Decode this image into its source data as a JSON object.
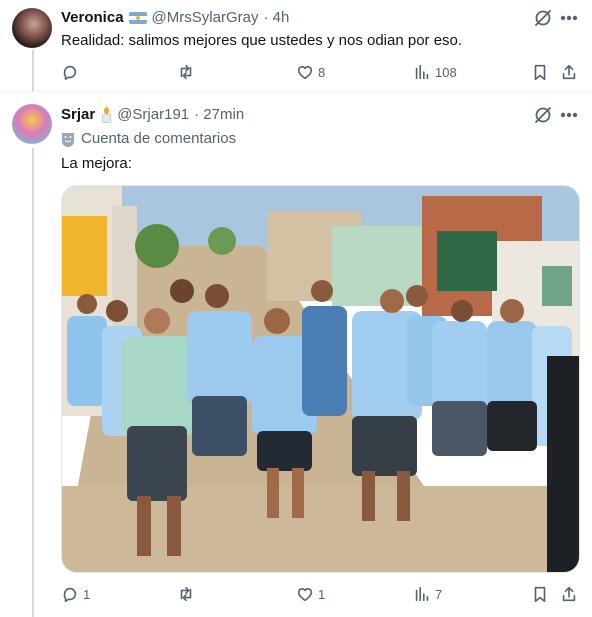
{
  "tweet1": {
    "name": "Veronica",
    "flag_emoji": "argentina-flag",
    "handle": "@MrsSylarGray",
    "time": "· 4h",
    "text": "Realidad: salimos mejores que ustedes y nos odian por eso.",
    "replies": "",
    "retweets": "",
    "likes": "8",
    "views": "108"
  },
  "tweet2": {
    "name": "Srjar",
    "handle": "@Srjar191",
    "time": "· 27min",
    "community_notes": "Cuenta de comentarios",
    "text": "La mejora:",
    "replies": "1",
    "retweets": "",
    "likes": "1",
    "views": "7"
  },
  "colors": {
    "text_primary": "#0f1419",
    "text_secondary": "#536471",
    "divider": "#eff3f4",
    "thread_line": "#cfd9de",
    "jersey_sky": "#8fc4ec"
  },
  "icons": [
    "reply-icon",
    "retweet-icon",
    "like-icon",
    "views-icon",
    "bookmark-icon",
    "share-icon",
    "grok-icon",
    "more-icon",
    "community-notes-icon",
    "candle-icon"
  ]
}
